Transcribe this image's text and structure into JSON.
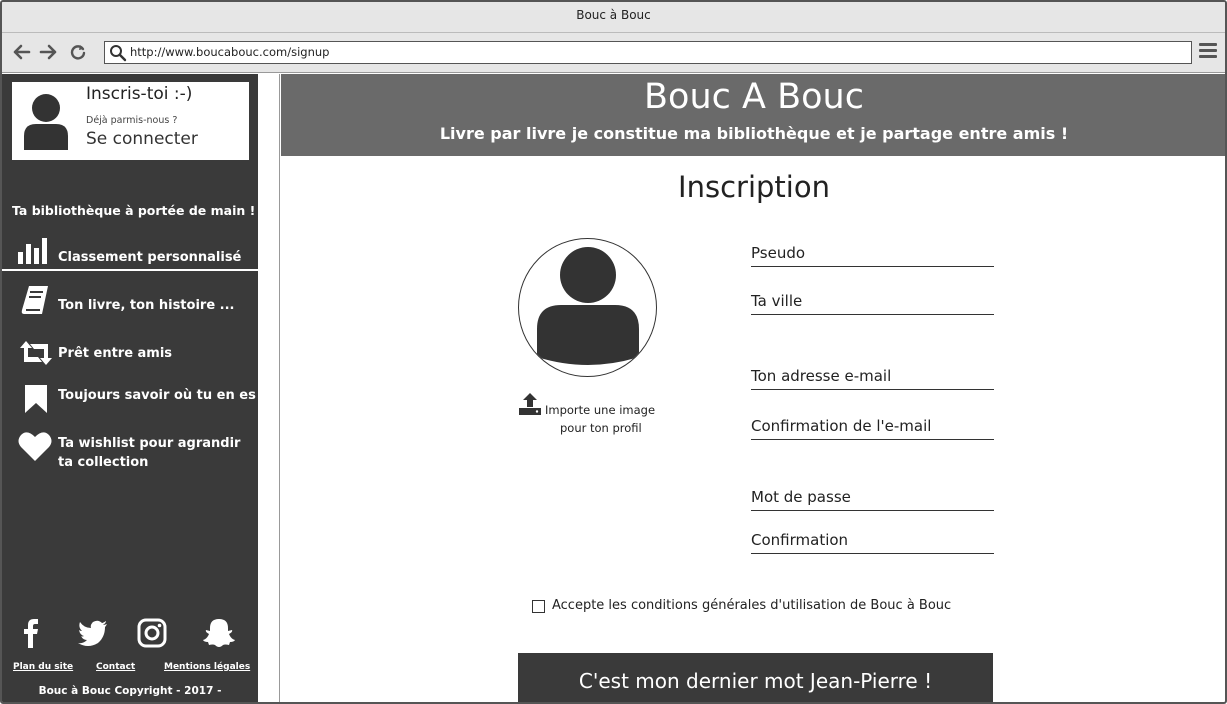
{
  "browser": {
    "window_title": "Bouc à Bouc",
    "url": "http://www.boucabouc.com/signup"
  },
  "sidebar": {
    "login": {
      "title": "Inscris-toi :-)",
      "already_member": "Déjà parmis-nous ?",
      "login_link": "Se connecter"
    },
    "tagline": "Ta bibliothèque à portée de main !",
    "features": [
      {
        "label": "Classement personnalisé",
        "icon": "bar-chart-icon"
      },
      {
        "label": "Ton livre, ton histoire ...",
        "icon": "book-icon"
      },
      {
        "label": "Prêt entre amis",
        "icon": "retweet-icon"
      },
      {
        "label": "Toujours savoir où tu en es",
        "icon": "bookmark-icon"
      },
      {
        "label_line1": "Ta wishlist pour agrandir",
        "label_line2": "ta collection",
        "icon": "heart-icon"
      }
    ],
    "socials": [
      "facebook-icon",
      "twitter-icon",
      "instagram-icon",
      "snapchat-icon"
    ],
    "footer_links": {
      "sitemap": "Plan du site",
      "contact": "Contact",
      "legal": "Mentions légales"
    },
    "copyright": "Bouc à Bouc Copyright - 2017 -"
  },
  "header": {
    "title": "Bouc A Bouc",
    "subtitle": "Livre par livre je constitue ma bibliothèque et je partage entre amis !"
  },
  "form": {
    "title": "Inscription",
    "upload_line1": "Importe une image",
    "upload_line2": "pour ton profil",
    "fields": {
      "pseudo": "Pseudo",
      "city": "Ta ville",
      "email": "Ton adresse e-mail",
      "email_confirm": "Confirmation de l'e-mail",
      "password": "Mot de passe",
      "password_confirm": "Confirmation"
    },
    "terms": "Accepte les conditions générales d'utilisation de Bouc à Bouc",
    "terms_checked": false,
    "submit": "C'est mon dernier mot Jean-Pierre !"
  },
  "colors": {
    "sidebar_bg": "#3a3a3a",
    "hero_bg": "#6a6a6a",
    "chrome_bg": "#e6e6e6"
  }
}
